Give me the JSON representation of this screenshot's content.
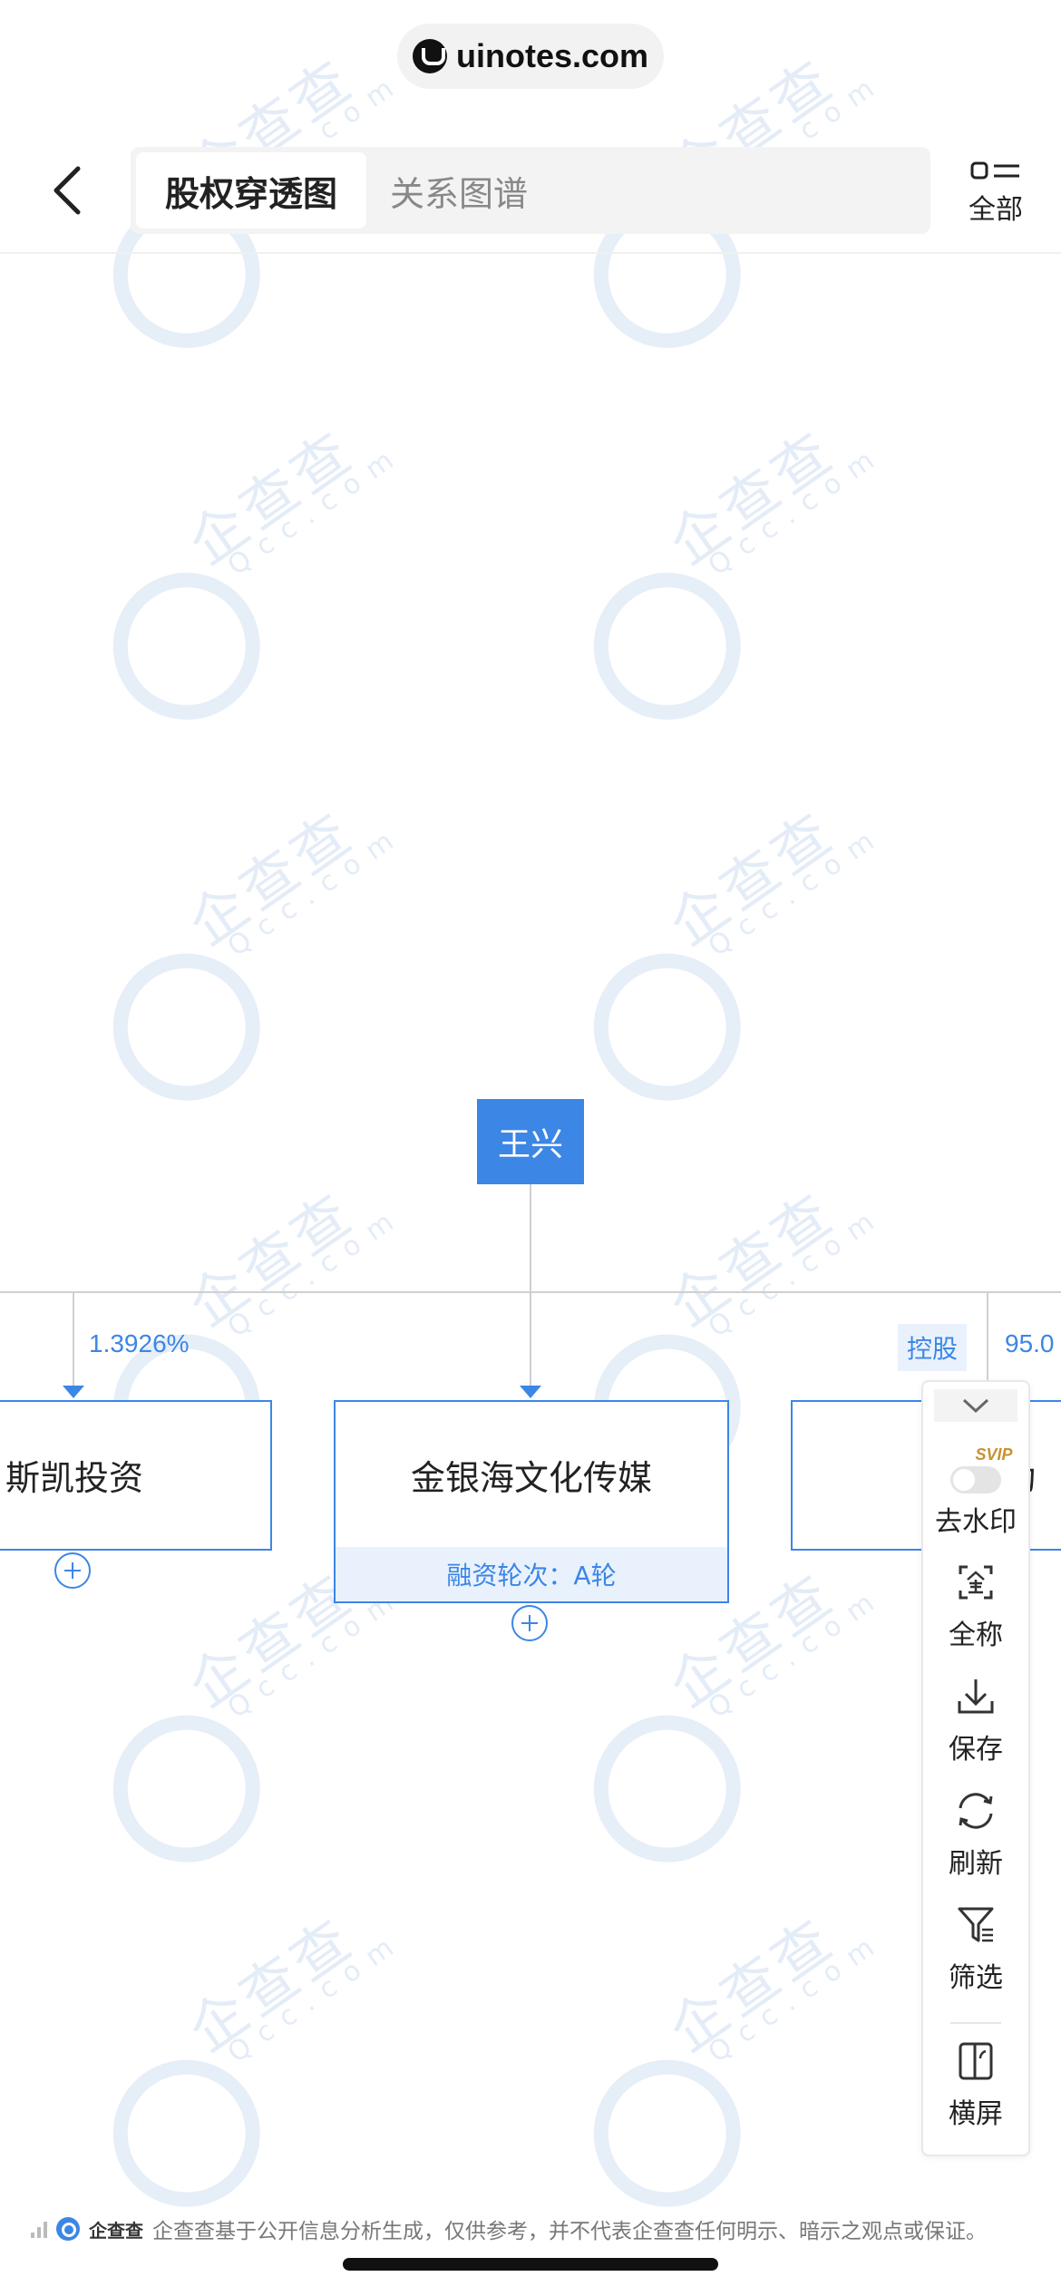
{
  "top_pill": {
    "site": "uinotes.com"
  },
  "header": {
    "tabs": [
      {
        "label": "股权穿透图",
        "active": true
      },
      {
        "label": "关系图谱",
        "active": false
      }
    ],
    "all_label": "全部"
  },
  "tree": {
    "root": {
      "name": "王兴"
    },
    "children": [
      {
        "name": "斯凯投资",
        "percent": "1.3926%",
        "badge": "",
        "funding": ""
      },
      {
        "name": "金银海文化传媒",
        "percent": "",
        "badge": "",
        "funding": "融资轮次：A轮"
      },
      {
        "name": "动",
        "percent": "95.0",
        "badge": "控股",
        "funding": ""
      }
    ]
  },
  "side_panel": {
    "items": [
      {
        "label": "去水印",
        "badge": "SVIP",
        "icon": "toggle-switch"
      },
      {
        "label": "全称",
        "icon": "fullname-icon"
      },
      {
        "label": "保存",
        "icon": "download-icon"
      },
      {
        "label": "刷新",
        "icon": "refresh-icon"
      },
      {
        "label": "筛选",
        "icon": "filter-icon"
      },
      {
        "label": "横屏",
        "icon": "rotate-landscape-icon"
      }
    ]
  },
  "watermark": {
    "brand": "企查查",
    "domain": "Qcc.com"
  },
  "footer": {
    "brand": "企查查",
    "disclaimer": "企查查基于公开信息分析生成，仅供参考，并不代表企查查任何明示、暗示之观点或保证。"
  },
  "colors": {
    "accent": "#3c86e6",
    "tint": "#e9f2fc",
    "svip": "#c8922f"
  }
}
